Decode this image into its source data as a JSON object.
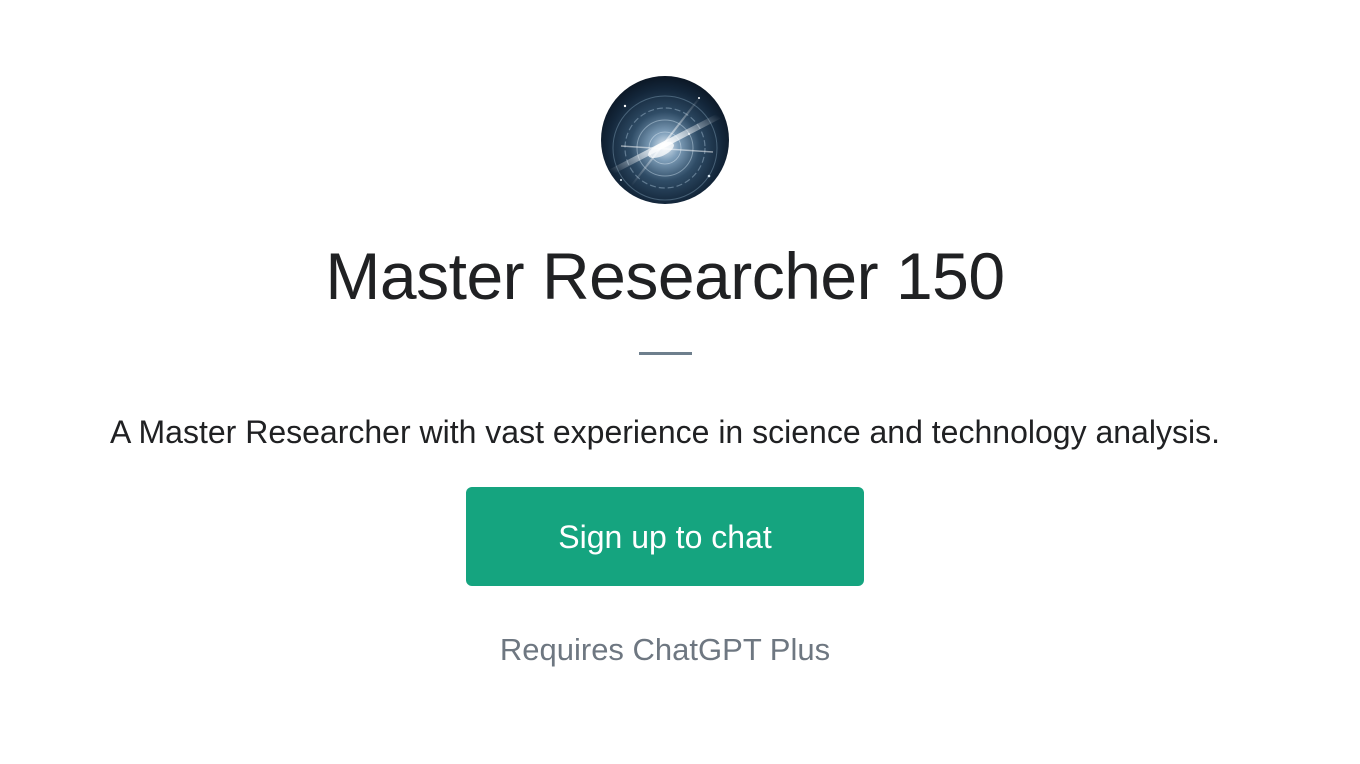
{
  "gpt": {
    "avatar_icon": "cosmic-vortex-avatar",
    "title": "Master Researcher 150",
    "description": "A Master Researcher with vast experience in science and technology analysis."
  },
  "actions": {
    "signup_label": "Sign up to chat",
    "requirement_note": "Requires ChatGPT Plus"
  },
  "colors": {
    "accent": "#15a47f",
    "title_text": "#202123",
    "muted_text": "#6e7781",
    "divider": "#6e7f8d"
  }
}
